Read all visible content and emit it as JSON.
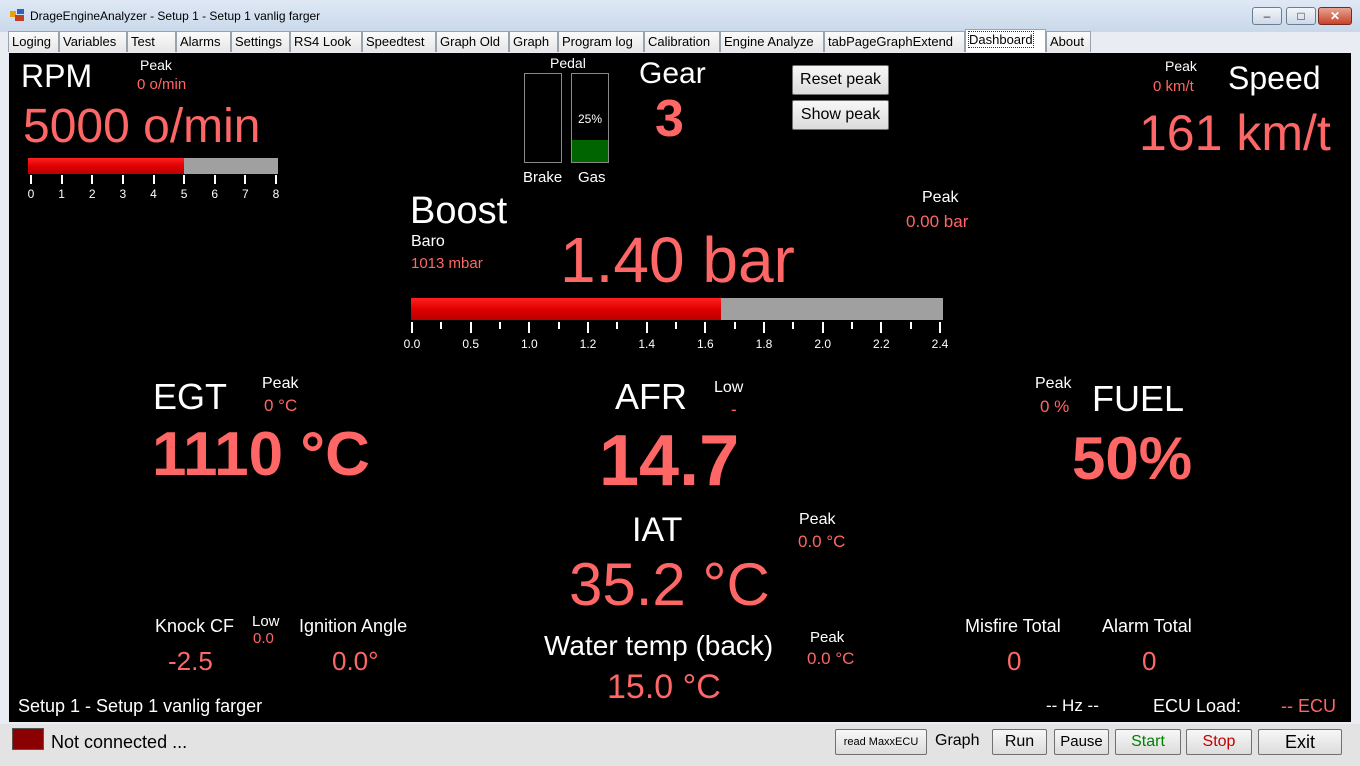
{
  "window": {
    "title": "DrageEngineAnalyzer - Setup 1 - Setup 1 vanlig farger",
    "minimize": "–",
    "maximize": "□",
    "close": "✕"
  },
  "tabs": [
    "Loging",
    "Variables",
    "Test",
    "Alarms",
    "Settings",
    "RS4 Look",
    "Speedtest",
    "Graph Old",
    "Graph",
    "Program log",
    "Calibration",
    "Engine Analyze",
    "tabPageGraphExtend",
    "Dashboard",
    "About"
  ],
  "active_tab": "Dashboard",
  "colors": {
    "value": "#ff6666",
    "label": "#ffffff",
    "background": "#000000",
    "bar_fill": "#ff0000",
    "bar_empty": "#a0a0a0",
    "gas_fill": "#006400",
    "status_disconnected": "#8b0000"
  },
  "rpm": {
    "label": "RPM",
    "peak_label": "Peak",
    "peak_value": "0 o/min",
    "value": "5000 o/min",
    "bar_fraction": 0.625,
    "ticks": [
      "0",
      "1",
      "2",
      "3",
      "4",
      "5",
      "6",
      "7",
      "8"
    ]
  },
  "pedal": {
    "label": "Pedal",
    "brake_label": "Brake",
    "gas_label": "Gas",
    "gas_percent_text": "25%",
    "gas_fraction": 0.25,
    "brake_fraction": 0
  },
  "gear": {
    "label": "Gear",
    "value": "3"
  },
  "buttons": {
    "reset_peak": "Reset peak",
    "show_peak": "Show peak"
  },
  "speed": {
    "label": "Speed",
    "peak_label": "Peak",
    "peak_value": "0 km/t",
    "value": "161 km/t"
  },
  "boost": {
    "label": "Boost",
    "baro_label": "Baro",
    "baro_value": "1013 mbar",
    "peak_label": "Peak",
    "peak_value": "0.00 bar",
    "value": "1.40 bar",
    "bar_fraction": 0.5833,
    "ticks": [
      "0.0",
      "0.5",
      "1.0",
      "1.2",
      "1.4",
      "1.6",
      "1.8",
      "2.0",
      "2.2",
      "2.4"
    ]
  },
  "egt": {
    "label": "EGT",
    "peak_label": "Peak",
    "peak_value": "0 °C",
    "value": "1110 °C"
  },
  "afr": {
    "label": "AFR",
    "low_label": "Low",
    "low_value": "-",
    "value": "14.7"
  },
  "fuel": {
    "label": "FUEL",
    "peak_label": "Peak",
    "peak_value": "0 %",
    "value": "50%"
  },
  "iat": {
    "label": "IAT",
    "peak_label": "Peak",
    "peak_value": "0.0 °C",
    "value": "35.2 °C"
  },
  "knock": {
    "label": "Knock CF",
    "low_label": "Low",
    "low_value": "0.0",
    "value": "-2.5"
  },
  "ignition": {
    "label": "Ignition Angle",
    "value": "0.0°"
  },
  "water": {
    "label": "Water temp (back)",
    "peak_label": "Peak",
    "peak_value": "0.0 °C",
    "value": "15.0 °C"
  },
  "misfire": {
    "label": "Misfire Total",
    "value": "0"
  },
  "alarm": {
    "label": "Alarm Total",
    "value": "0"
  },
  "footer": {
    "setup_name": "Setup 1 - Setup 1 vanlig farger",
    "hz": "-- Hz --",
    "ecu_load_label": "ECU Load:",
    "ecu_value": "-- ECU"
  },
  "status": {
    "connection": "Not connected ...",
    "read_button": "read MaxxECU",
    "graph_label": "Graph",
    "run": "Run",
    "pause": "Pause",
    "start": "Start",
    "stop": "Stop",
    "exit": "Exit"
  }
}
